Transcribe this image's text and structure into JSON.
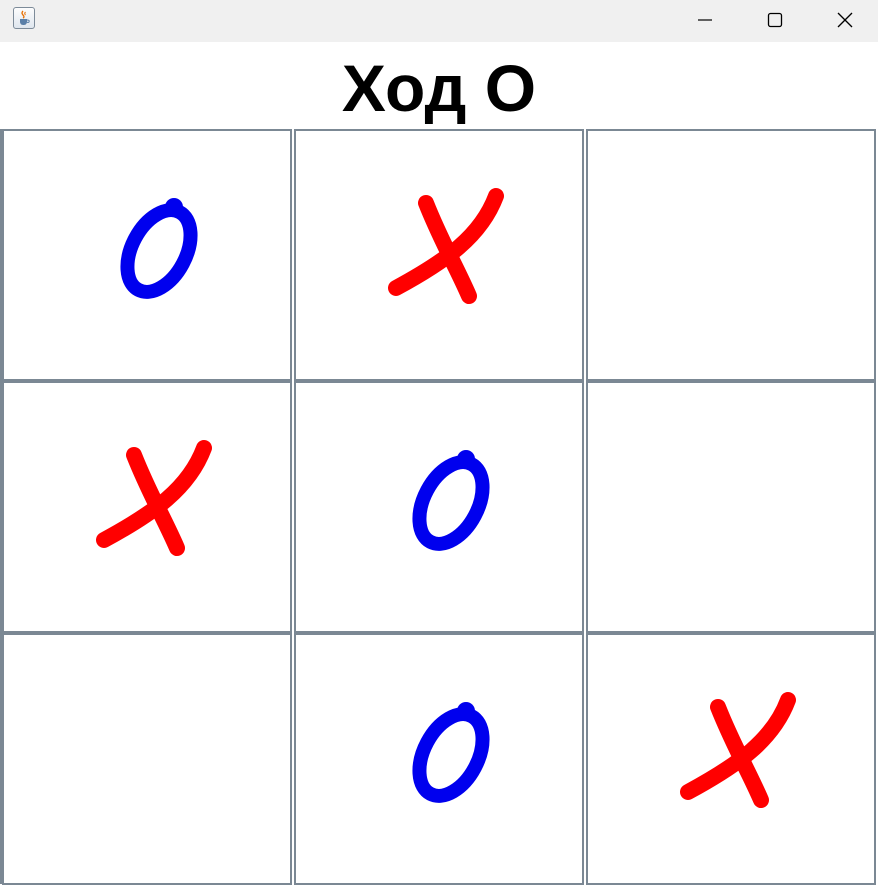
{
  "window": {
    "title": "",
    "icon": "java-cup-icon",
    "controls": [
      "minimize-icon",
      "maximize-icon",
      "close-icon"
    ]
  },
  "status": {
    "text": "Ход O"
  },
  "board": {
    "cells": [
      {
        "row": 1,
        "col": 1,
        "mark": "O"
      },
      {
        "row": 1,
        "col": 2,
        "mark": "X"
      },
      {
        "row": 1,
        "col": 3,
        "mark": ""
      },
      {
        "row": 2,
        "col": 1,
        "mark": "X"
      },
      {
        "row": 2,
        "col": 2,
        "mark": "O"
      },
      {
        "row": 2,
        "col": 3,
        "mark": ""
      },
      {
        "row": 3,
        "col": 1,
        "mark": ""
      },
      {
        "row": 3,
        "col": 2,
        "mark": "O"
      },
      {
        "row": 3,
        "col": 3,
        "mark": "X"
      }
    ]
  },
  "colors": {
    "x_mark": "#ff0000",
    "o_mark": "#0000ee",
    "grid_line": "#7b8894",
    "titlebar": "#f0f0f0"
  }
}
